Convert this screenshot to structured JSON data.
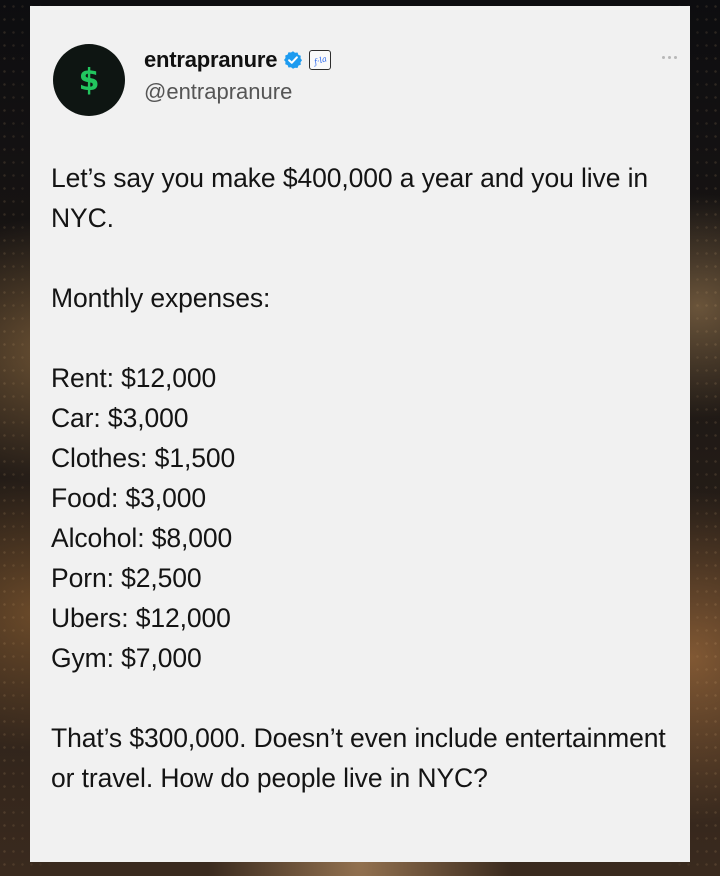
{
  "post": {
    "author": {
      "display_name": "entrapranure",
      "handle": "@entrapranure",
      "avatar_symbol": "$",
      "verified": true,
      "affiliate_badge_icon": "signature-badge-icon"
    },
    "intro": "Let’s say you make $400,000 a year and you live in NYC.",
    "expenses_heading": "Monthly expenses:",
    "expenses": [
      {
        "label": "Rent: $12,000"
      },
      {
        "label": "Car: $3,000"
      },
      {
        "label": "Clothes: $1,500"
      },
      {
        "label": "Food: $3,000"
      },
      {
        "label": "Alcohol: $8,000"
      },
      {
        "label": "Porn: $2,500"
      },
      {
        "label": "Ubers: $12,000"
      },
      {
        "label": "Gym: $7,000"
      }
    ],
    "conclusion": "That’s $300,000. Doesn’t even include entertainment or travel. How do people live in NYC?"
  },
  "colors": {
    "card_background": "#f1f1f1",
    "text": "#141414",
    "handle_text": "#555555",
    "verified_blue": "#1d9bf0",
    "avatar_dollar_green": "#22c55e"
  }
}
